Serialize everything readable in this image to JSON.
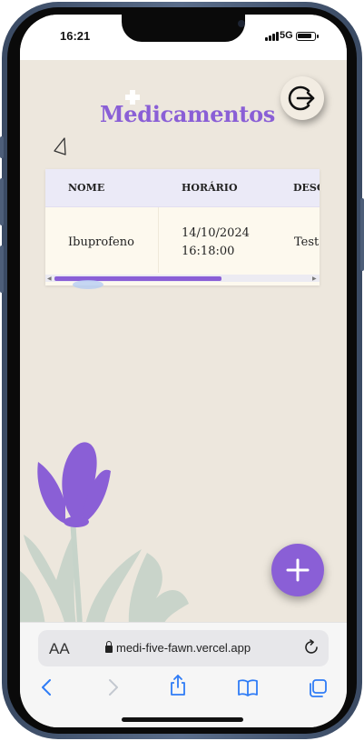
{
  "status_bar": {
    "time": "16:21",
    "network": "5G"
  },
  "app": {
    "title": "Medicamentos",
    "table": {
      "headers": [
        "NOME",
        "HORÁRIO",
        "DESC"
      ],
      "rows": [
        {
          "nome": "Ibuprofeno",
          "horario_line1": "14/10/2024",
          "horario_line2": "16:18:00",
          "descricao": "Test"
        }
      ]
    },
    "icons": {
      "logout": "logout-icon",
      "add": "plus-icon",
      "back": "triangle-back-icon"
    },
    "colors": {
      "accent": "#8a5fd6",
      "background": "#ede7dd",
      "table_header": "#ebeaf7"
    }
  },
  "browser": {
    "aa_label": "AA",
    "url": "medi-five-fawn.vercel.app"
  }
}
